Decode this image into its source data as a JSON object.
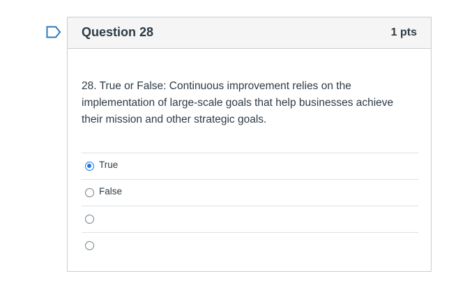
{
  "question": {
    "title": "Question 28",
    "points": "1 pts",
    "text": "28. True or False: Continuous improvement relies on the implementation of large-scale goals that help businesses achieve their mission and other strategic goals.",
    "flag_icon": "flag-icon",
    "answers": [
      {
        "label": "True",
        "selected": true
      },
      {
        "label": "False",
        "selected": false
      },
      {
        "label": "",
        "selected": false
      },
      {
        "label": "",
        "selected": false
      }
    ]
  },
  "colors": {
    "accent": "#1a73e8",
    "flag": "#2b7abc",
    "header_bg": "#f5f5f5",
    "border": "#c7cdd1"
  }
}
